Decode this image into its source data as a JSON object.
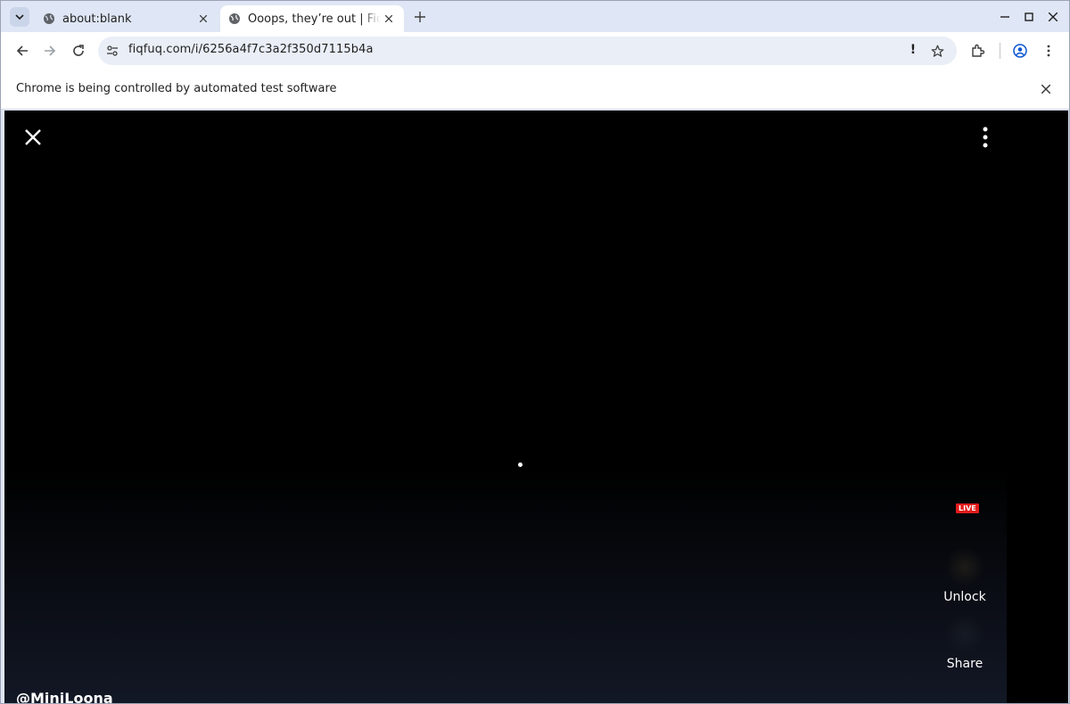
{
  "browser": {
    "tabs": [
      {
        "title": "about:blank",
        "active": false
      },
      {
        "title": "Ooops, they’re out | FiqFuq",
        "active": true
      }
    ],
    "toolbar": {
      "url": "fiqfuq.com/i/6256a4f7c3a2f350d7115b4a",
      "url_warning": "!"
    },
    "infobar": {
      "message": "Chrome is being controlled by automated test software"
    }
  },
  "viewer": {
    "live_badge": "LIVE",
    "actions": {
      "unlock_label": "Unlock",
      "share_label": "Share"
    },
    "creator_handle": "@MiniLoona"
  },
  "colors": {
    "tabstrip_bg": "#dfe6f5",
    "omnibox_bg": "#e9eef7",
    "viewer_bg": "#000000",
    "live_badge": "#e21b1b"
  },
  "icons": [
    "tab-search-icon",
    "globe-icon",
    "close-icon",
    "plus-icon",
    "minimize-icon",
    "maximize-icon",
    "back-arrow-icon",
    "forward-arrow-icon",
    "reload-icon",
    "site-info-icon",
    "star-icon",
    "extensions-icon",
    "profile-icon",
    "more-vert-icon"
  ]
}
